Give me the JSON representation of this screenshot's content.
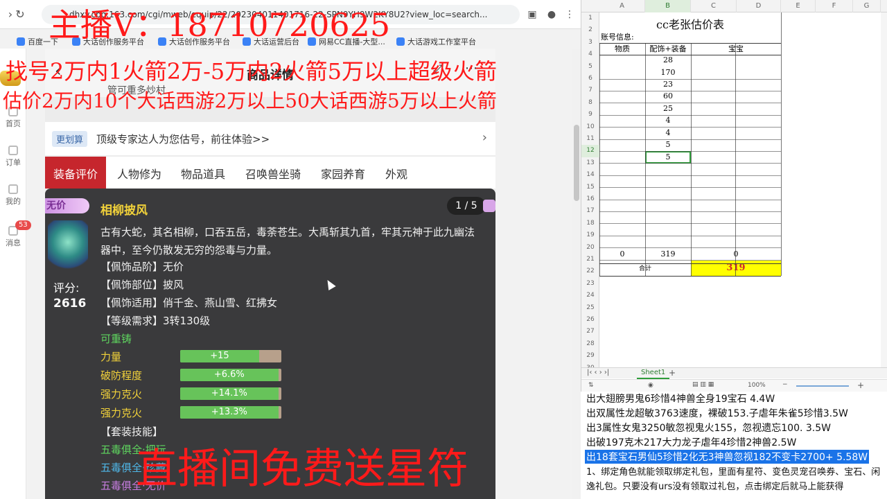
{
  "browser": {
    "url": "dhxy.cbg.163.com/cgi/mweb/equip/22/202304011401716-22-SPN9YH9W2KY8U2?view_loc=search...",
    "bookmarks": [
      "百度一下",
      "大话创作服务平台",
      "大话创作服务平台",
      "大话运营后台",
      "网易CC直播-大型...",
      "大话游戏工作室平台"
    ],
    "page_title": "商品详情",
    "subbar_text": "管可重多炒村",
    "promo_tag": "更划算",
    "promo_text": "顶级专家达人为您估号，前往体验>>",
    "tabs": [
      "装备评价",
      "人物修为",
      "物品道具",
      "召唤兽坐骑",
      "家园养育",
      "外观"
    ],
    "sidebar": {
      "home": "首页",
      "order": "订单",
      "mine": "我的",
      "messages": "消息",
      "badge": "53"
    }
  },
  "item": {
    "price_badge": "无价",
    "name": "相柳披风",
    "counter": "1 / 5",
    "description": "古有大蛇，其名相柳，口吞五岳，毒荼苍生。大禹斩其九首，牢其元神于此九幽法器中，至今仍散发无穷的怨毒与力量。",
    "score_label": "评分:",
    "score_value": "2616",
    "attrs": [
      "【佩饰品阶】无价",
      "【佩饰部位】披风",
      "【佩饰适用】俏千金、燕山雪、红拂女",
      "【等级需求】3转130级"
    ],
    "recast": "可重铸",
    "stats": [
      {
        "label": "力量",
        "value": "+15",
        "fill": 0.78
      },
      {
        "label": "破防程度",
        "value": "+6.6%",
        "fill": 0.97
      },
      {
        "label": "强力克火",
        "value": "+14.1%",
        "fill": 0.97
      },
      {
        "label": "强力克火",
        "value": "+13.3%",
        "fill": 0.97
      }
    ],
    "set_skill_label": "【套装技能】",
    "set_skills": [
      {
        "text": "五毒俱全·把玩",
        "color": "#5fd65f"
      },
      {
        "text": "五毒俱全·珍藏",
        "color": "#4fb7e8"
      },
      {
        "text": "五毒俱全·无价",
        "color": "#c77de0"
      }
    ]
  },
  "sheet": {
    "title": "cc老张估价表",
    "account_label": "账号信息:",
    "headers": [
      "物质",
      "配饰+装备",
      "宝宝"
    ],
    "col_letters": [
      "A",
      "B",
      "C",
      "D",
      "E",
      "F",
      "G"
    ],
    "b_values": [
      "28",
      "170",
      "23",
      "60",
      "25",
      "4",
      "4",
      "5",
      "5"
    ],
    "totals": [
      "0",
      "319",
      "0"
    ],
    "sum_label": "合计",
    "sum_value": "319",
    "tab_name": "Sheet1",
    "zoom": "100%"
  },
  "ticker": [
    {
      "text": "出大翅膀男鬼6珍惜4神兽全身19宝石 4.4W",
      "highlight": false
    },
    {
      "text": "出双属性龙超敏3763速度，裸破153.子虐年朱雀5珍惜3.5W",
      "highlight": false
    },
    {
      "text": "出3属性女鬼3250敏忽视鬼火155，忽视遗忘100. 3.5W",
      "highlight": false
    },
    {
      "text": "出破197克木217大力龙子虐年4珍惜2神兽2.5W",
      "highlight": false
    },
    {
      "text": "出18套宝石男仙5珍惜2化无3神兽忽视182不变卡2700+ 5.58W",
      "highlight": true
    }
  ],
  "ticker_rule": "1、绑定角色就能领取绑定礼包，里面有星符、变色灵宠召唤券、宝石、闲逸礼包。只要没有urs没有领取过礼包，点击绑定后就马上能获得",
  "overlays": {
    "contact": "主播V：18710720625",
    "line1": "找号2万内1火箭2万-5万内2火箭5万以上超级火箭",
    "line2": "估价2万内10个大话西游2万以上50大话西游5万以上火箭",
    "bottom": "直播间免费送星符"
  },
  "colors": {
    "overlay_red": "#ff1a1a",
    "tab_active": "#c6262d",
    "item_name": "#f2d23a",
    "stat_green": "#67c35a",
    "total_yellow": "#ffff00",
    "ticker_highlight": "#1a73e8"
  }
}
